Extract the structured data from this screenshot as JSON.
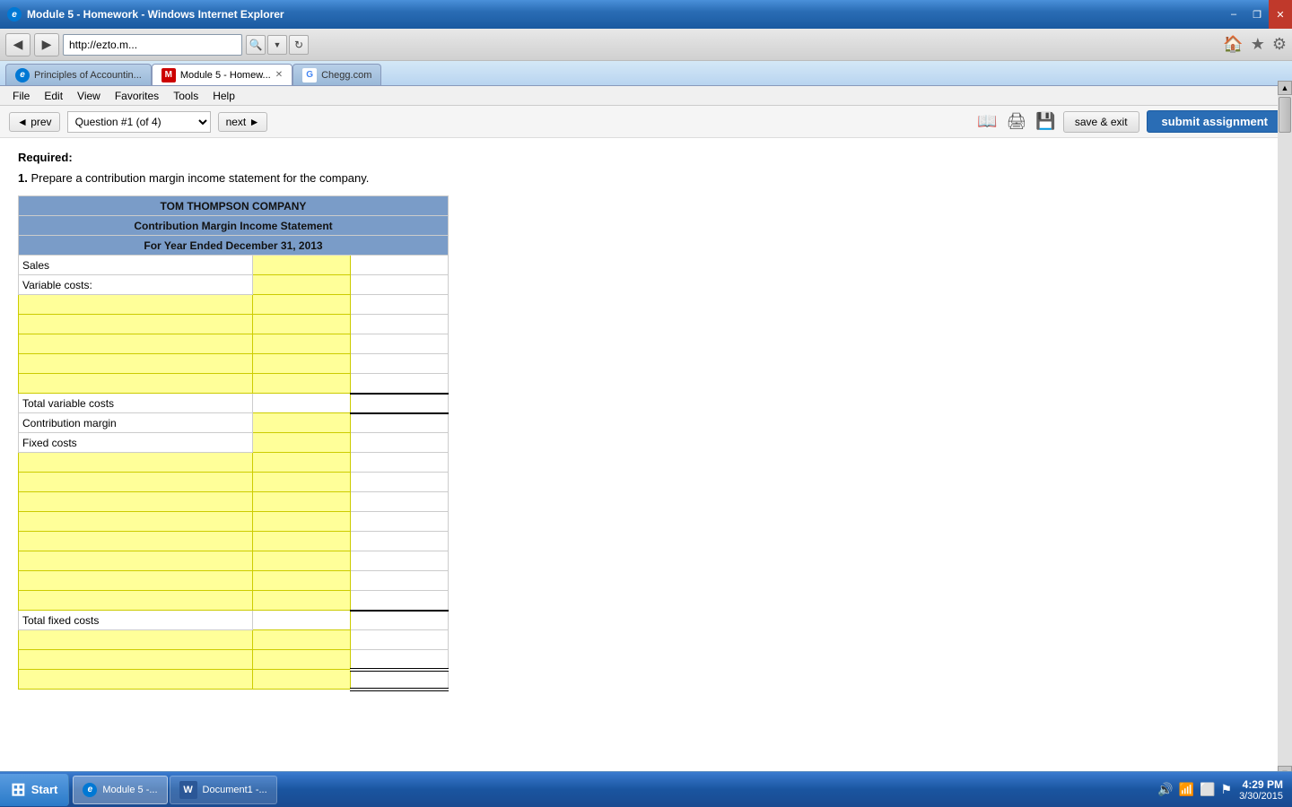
{
  "titlebar": {
    "title": "Module 5 - Homework - Windows Internet Explorer",
    "min_label": "–",
    "restore_label": "❐",
    "close_label": "✕"
  },
  "menubar": {
    "items": [
      "File",
      "Edit",
      "View",
      "Favorites",
      "Tools",
      "Help"
    ]
  },
  "toolbar": {
    "back_label": "◀",
    "forward_label": "▶",
    "address": "http://ezto.m...",
    "refresh_label": "↻"
  },
  "tabs": [
    {
      "label": "Principles of Accountin...",
      "type": "ie",
      "active": false
    },
    {
      "label": "Module 5 - Homew...",
      "type": "m",
      "active": true
    },
    {
      "label": "Chegg.com",
      "type": "g",
      "active": false
    }
  ],
  "content_toolbar": {
    "prev_label": "◄ prev",
    "question_selector": "Question #1 (of 4)",
    "next_label": "next ►",
    "save_exit_label": "save & exit",
    "submit_label": "submit assignment"
  },
  "content": {
    "required_label": "Required:",
    "question_number": "1.",
    "question_text": "Prepare a contribution margin income statement for the company.",
    "table": {
      "company_name": "TOM THOMPSON COMPANY",
      "statement_title": "Contribution Margin Income Statement",
      "period": "For Year Ended December 31, 2013",
      "rows": [
        {
          "label": "Sales",
          "type": "data"
        },
        {
          "label": "Variable costs:",
          "type": "section"
        },
        {
          "label": "",
          "type": "input"
        },
        {
          "label": "",
          "type": "input"
        },
        {
          "label": "",
          "type": "input"
        },
        {
          "label": "",
          "type": "input"
        },
        {
          "label": "",
          "type": "input"
        },
        {
          "label": "",
          "type": "input"
        },
        {
          "label": "Total variable costs",
          "type": "total"
        },
        {
          "label": "Contribution margin",
          "type": "contribution"
        },
        {
          "label": "Fixed costs",
          "type": "section"
        },
        {
          "label": "",
          "type": "input"
        },
        {
          "label": "",
          "type": "input"
        },
        {
          "label": "",
          "type": "input"
        },
        {
          "label": "",
          "type": "input"
        },
        {
          "label": "",
          "type": "input"
        },
        {
          "label": "",
          "type": "input"
        },
        {
          "label": "",
          "type": "input"
        },
        {
          "label": "",
          "type": "input"
        },
        {
          "label": "Total fixed costs",
          "type": "total"
        },
        {
          "label": "",
          "type": "net1"
        },
        {
          "label": "",
          "type": "net2"
        },
        {
          "label": "",
          "type": "net3"
        }
      ]
    }
  },
  "taskbar": {
    "start_label": "Start",
    "items": [
      {
        "label": "Module 5 -...",
        "type": "ie"
      },
      {
        "label": "Document1 -...",
        "type": "word"
      }
    ],
    "time": "4:29 PM",
    "date": "3/30/2015"
  }
}
